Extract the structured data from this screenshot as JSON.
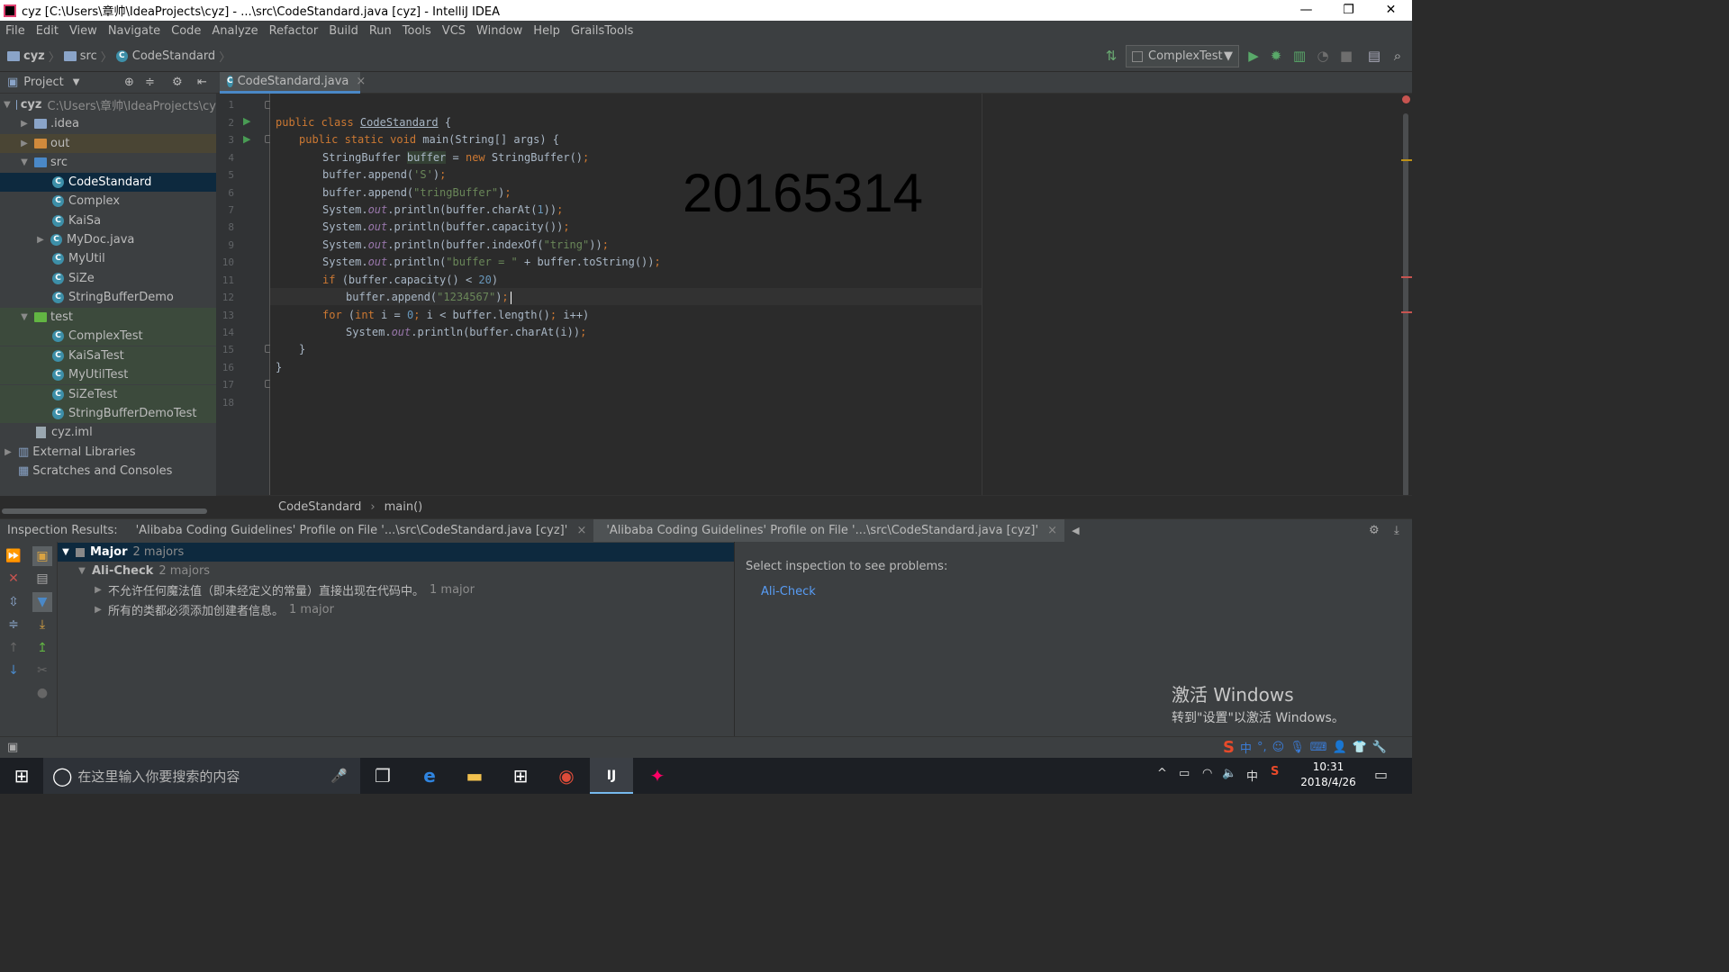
{
  "window": {
    "title": "cyz [C:\\Users\\章帅\\IdeaProjects\\cyz] - ...\\src\\CodeStandard.java [cyz] - IntelliJ IDEA",
    "minimize": "—",
    "restore": "❐",
    "close": "✕"
  },
  "menu": [
    "File",
    "Edit",
    "View",
    "Navigate",
    "Code",
    "Analyze",
    "Refactor",
    "Build",
    "Run",
    "Tools",
    "VCS",
    "Window",
    "Help",
    "GrailsTools"
  ],
  "navbar": {
    "crumbs": [
      "cyz",
      "src",
      "CodeStandard"
    ],
    "run_config": "ComplexTest"
  },
  "project": {
    "header": "Project",
    "tree": [
      {
        "label": "cyz",
        "extra": "C:\\Users\\章帅\\IdeaProjects\\cy",
        "depth": 0,
        "arrow": "▼",
        "icon": "module"
      },
      {
        "label": ".idea",
        "depth": 1,
        "arrow": "▶",
        "icon": "folder"
      },
      {
        "label": "out",
        "depth": 1,
        "arrow": "▶",
        "icon": "folder-orange"
      },
      {
        "label": "src",
        "depth": 1,
        "arrow": "▼",
        "icon": "folder-blue"
      },
      {
        "label": "CodeStandard",
        "depth": 2,
        "arrow": "",
        "icon": "class"
      },
      {
        "label": "Complex",
        "depth": 2,
        "arrow": "",
        "icon": "class"
      },
      {
        "label": "KaiSa",
        "depth": 2,
        "arrow": "",
        "icon": "class"
      },
      {
        "label": "MyDoc.java",
        "depth": 2,
        "arrow": "▶",
        "icon": "class"
      },
      {
        "label": "MyUtil",
        "depth": 2,
        "arrow": "",
        "icon": "class"
      },
      {
        "label": "SiZe",
        "depth": 2,
        "arrow": "",
        "icon": "class"
      },
      {
        "label": "StringBufferDemo",
        "depth": 2,
        "arrow": "",
        "icon": "class"
      },
      {
        "label": "test",
        "depth": 1,
        "arrow": "▼",
        "icon": "folder-green"
      },
      {
        "label": "ComplexTest",
        "depth": 2,
        "arrow": "",
        "icon": "class"
      },
      {
        "label": "KaiSaTest",
        "depth": 2,
        "arrow": "",
        "icon": "class"
      },
      {
        "label": "MyUtilTest",
        "depth": 2,
        "arrow": "",
        "icon": "class"
      },
      {
        "label": "SiZeTest",
        "depth": 2,
        "arrow": "",
        "icon": "class"
      },
      {
        "label": "StringBufferDemoTest",
        "depth": 2,
        "arrow": "",
        "icon": "class"
      },
      {
        "label": "cyz.iml",
        "depth": 1,
        "arrow": "",
        "icon": "file"
      },
      {
        "label": "External Libraries",
        "depth": 0,
        "arrow": "▶",
        "icon": "library"
      },
      {
        "label": "Scratches and Consoles",
        "depth": 0,
        "arrow": "",
        "icon": "scratch"
      }
    ]
  },
  "editor": {
    "tab": "CodeStandard.java",
    "tab_close": "×",
    "line_numbers": [
      "1",
      "2",
      "3",
      "4",
      "5",
      "6",
      "7",
      "8",
      "9",
      "10",
      "11",
      "12",
      "13",
      "14",
      "15",
      "16",
      "17",
      "18"
    ],
    "overlay_text": "20165314",
    "breadcrumb": [
      "CodeStandard",
      "main()"
    ],
    "breadcrumb_sep": "›",
    "code": {
      "l2_kw": "public class ",
      "l2_name": "CodeStandard",
      "l2_rest": " {",
      "l3_kw": "public static void ",
      "l3_rest": "main(String[] args) {",
      "l4_a": "StringBuffer ",
      "l4_b": "buffer",
      "l4_c": " = ",
      "l4_kw": "new ",
      "l4_d": "StringBuffer()",
      "l4_semi": ";",
      "l5_a": "buffer.append(",
      "l5_str": "'S'",
      "l5_b": ")",
      "l5_semi": ";",
      "l6_a": "buffer.append(",
      "l6_str": "\"tringBuffer\"",
      "l6_b": ")",
      "l6_semi": ";",
      "sys": "System.",
      "out": "out",
      "l7_rest": ".println(buffer.charAt(",
      "l7_num": "1",
      "l7_end": "))",
      "l7_semi": ";",
      "l8_rest": ".println(buffer.capacity())",
      "l8_semi": ";",
      "l9_rest": ".println(buffer.indexOf(",
      "l9_str": "\"tring\"",
      "l9_end": "))",
      "l9_semi": ";",
      "l10_rest": ".println(",
      "l10_str": "\"buffer = \"",
      "l10_end": " + buffer.toString())",
      "l10_semi": ";",
      "l11_kw": "if ",
      "l11_rest": "(buffer.capacity() < ",
      "l11_num": "20",
      "l11_end": ")",
      "l12_a": "buffer.append(",
      "l12_str": "\"1234567\"",
      "l12_b": ")",
      "l12_semi": ";",
      "l13_kw": "for ",
      "l13_rest": "(",
      "l13_kw2": "int ",
      "l13_mid": "i = ",
      "l13_num": "0",
      "l13_semi1": "; ",
      "l13_mid2": "i < buffer.length()",
      "l13_semi2": "; ",
      "l13_end": "i++)",
      "l14_rest": ".println(buffer.charAt(i))",
      "l14_semi": ";",
      "l15": "}",
      "l16": "}"
    }
  },
  "inspection": {
    "title": "Inspection Results:",
    "tabs": [
      "'Alibaba Coding Guidelines' Profile on File '...\\src\\CodeStandard.java [cyz]'",
      "'Alibaba Coding Guidelines' Profile on File '...\\src\\CodeStandard.java [cyz]'"
    ],
    "tab_close": "×",
    "tree": [
      {
        "label": "Major",
        "count": "2 majors"
      },
      {
        "label": "Ali-Check",
        "count": "2 majors"
      },
      {
        "label": "不允许任何魔法值（即未经定义的常量）直接出现在代码中。",
        "count": "1 major"
      },
      {
        "label": "所有的类都必须添加创建者信息。",
        "count": "1 major"
      }
    ],
    "detail_prompt": "Select inspection to see problems:",
    "detail_link": "Ali-Check"
  },
  "activate_windows": {
    "title": "激活 Windows",
    "subtitle": "转到\"设置\"以激活 Windows。"
  },
  "taskbar": {
    "search_placeholder": "在这里输入你要搜索的内容",
    "time": "10:31",
    "date": "2018/4/26",
    "ime_lang": "中",
    "ime_bar_text": "中"
  }
}
